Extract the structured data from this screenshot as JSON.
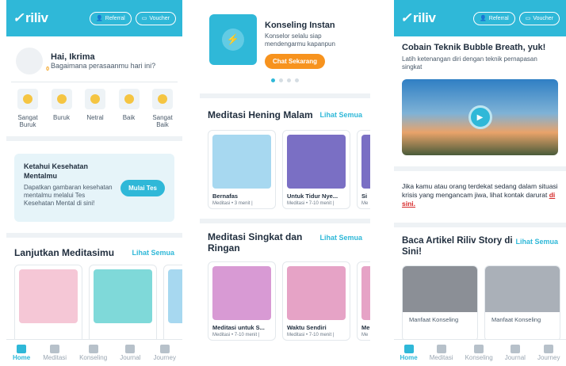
{
  "brand": {
    "logo": "riliv",
    "accent": "#2fb8d8",
    "orange": "#f7931e"
  },
  "header": {
    "referral": "Referral",
    "voucher": "Voucher"
  },
  "home": {
    "greeting": "Hai, Ikrima",
    "subtitle": "Bagaimana perasaanmu hari ini?",
    "points": "0",
    "moods": [
      {
        "label": "Sangat Buruk",
        "icon": "very-sad-face-icon"
      },
      {
        "label": "Buruk",
        "icon": "sad-face-icon"
      },
      {
        "label": "Netral",
        "icon": "neutral-face-icon"
      },
      {
        "label": "Baik",
        "icon": "happy-face-icon"
      },
      {
        "label": "Sangat Baik",
        "icon": "very-happy-face-icon"
      }
    ],
    "health_card": {
      "title": "Ketahui Kesehatan Mentalmu",
      "text": "Dapatkan gambaran kesehatan mentalmu melalui Tes Kesehatan Mental di sini!",
      "button": "Mulai Tes"
    },
    "continue_section": {
      "title": "Lanjutkan Meditasimu",
      "see_all": "Lihat Semua"
    }
  },
  "navbar": {
    "items": [
      "Home",
      "Meditasi",
      "Konseling",
      "Journal",
      "Journey"
    ],
    "active": "Home"
  },
  "counseling": {
    "title": "Konseling Instan",
    "text": "Konselor selalu siap mendengarmu kapanpun",
    "button": "Chat Sekarang"
  },
  "night_section": {
    "title": "Meditasi Hening Malam",
    "see_all": "Lihat Semua",
    "cards": [
      {
        "title": "Bernafas",
        "meta": "Meditasi • 3 menit |"
      },
      {
        "title": "Untuk Tidur Nye...",
        "meta": "Meditasi • 7-10 menit |"
      },
      {
        "title": "Si",
        "meta": "Me"
      }
    ]
  },
  "short_section": {
    "title": "Meditasi Singkat dan Ringan",
    "see_all": "Lihat Semua",
    "cards": [
      {
        "title": "Meditasi untuk S...",
        "meta": "Meditasi • 7-10 menit |"
      },
      {
        "title": "Waktu Sendiri",
        "meta": "Meditasi • 7-10 menit |"
      },
      {
        "title": "Me",
        "meta": "Me"
      }
    ]
  },
  "bubble": {
    "title": "Cobain Teknik Bubble Breath, yuk!",
    "text": "Latih ketenangan diri dengan teknik pernapasan singkat"
  },
  "crisis": {
    "text": "Jika kamu atau orang terdekat sedang dalam situasi krisis yang mengancam jiwa, lihat kontak darurat",
    "link": "di sini."
  },
  "articles": {
    "title": "Baca Artikel Riliv Story di Sini!",
    "see_all": "Lihat Semua",
    "cards": [
      {
        "title": "Manfaat Konseling"
      },
      {
        "title": "Manfaat Konseling"
      }
    ]
  }
}
